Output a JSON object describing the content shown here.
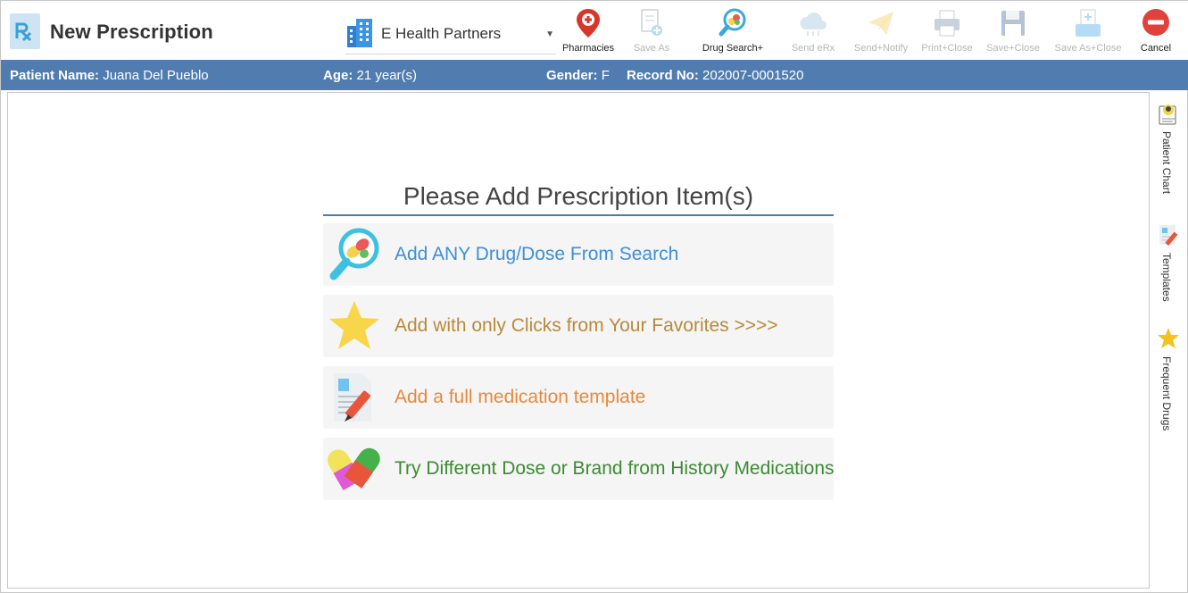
{
  "header": {
    "title": "New Prescription",
    "organization": {
      "selected": "E Health Partners"
    }
  },
  "toolbar": {
    "pharmacies": "Pharmacies",
    "save_as": "Save As",
    "drug_search": "Drug Search+",
    "send_erx": "Send eRx",
    "send_notify": "Send+Notify",
    "print_close": "Print+Close",
    "save_close": "Save+Close",
    "save_as_close": "Save As+Close",
    "cancel": "Cancel"
  },
  "patient": {
    "name_label": "Patient Name:",
    "name": "Juana Del Pueblo",
    "age_label": "Age:",
    "age": "21 year(s)",
    "gender_label": "Gender:",
    "gender": "F",
    "record_label": "Record No:",
    "record": "202007-0001520"
  },
  "main": {
    "prompt": "Please Add Prescription Item(s)",
    "actions": [
      {
        "label": "Add ANY Drug/Dose From Search",
        "color": "#3d8fd9",
        "icon": "drug-search-icon"
      },
      {
        "label": "Add with only Clicks from Your Favorites >>>>",
        "color": "#b88a3a",
        "icon": "star-icon"
      },
      {
        "label": "Add a full medication template",
        "color": "#e8883a",
        "icon": "template-icon"
      },
      {
        "label": "Try Different Dose or Brand from History Medications",
        "color": "#3d8a34",
        "icon": "capsule-icon"
      }
    ]
  },
  "side_rail": {
    "items": [
      {
        "label": "Patient Chart",
        "icon": "patient-chart-icon"
      },
      {
        "label": "Templates",
        "icon": "templates-icon"
      },
      {
        "label": "Frequent Drugs",
        "icon": "frequent-drugs-icon"
      }
    ]
  },
  "colors": {
    "patient_bar": "#507caf",
    "accent": "#4f7ab0",
    "cancel_red": "#e0413a",
    "disabled_text": "#b5b5b5"
  }
}
